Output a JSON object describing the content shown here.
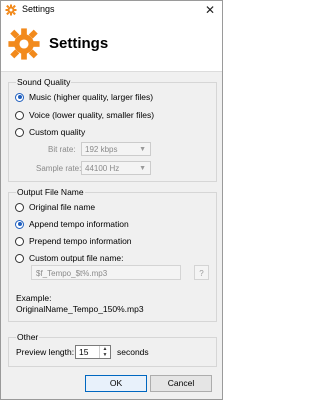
{
  "window": {
    "title": "Settings",
    "close_glyph": "✕"
  },
  "header": {
    "title": "Settings",
    "icon": "gear-icon"
  },
  "sound_quality": {
    "label": "Sound Quality",
    "options": [
      {
        "label": "Music (higher quality, larger files)",
        "selected": true
      },
      {
        "label": "Voice (lower quality, smaller files)",
        "selected": false
      },
      {
        "label": "Custom quality",
        "selected": false
      }
    ],
    "bit_rate_label": "Bit rate:",
    "bit_rate_value": "192 kbps",
    "sample_rate_label": "Sample rate:",
    "sample_rate_value": "44100 Hz"
  },
  "output_file_name": {
    "label": "Output File Name",
    "options": [
      {
        "label": "Original file name",
        "selected": false
      },
      {
        "label": "Append tempo information",
        "selected": true
      },
      {
        "label": "Prepend tempo information",
        "selected": false
      },
      {
        "label": "Custom output file name:",
        "selected": false
      }
    ],
    "custom_pattern": "$f_Tempo_$t%.mp3",
    "help_button": "?",
    "example_label": "Example:",
    "example_value": "OriginalName_Tempo_150%.mp3"
  },
  "other": {
    "label": "Other",
    "preview_label": "Preview length:",
    "preview_value": "15",
    "preview_unit": "seconds"
  },
  "buttons": {
    "ok": "OK",
    "cancel": "Cancel"
  },
  "colors": {
    "accent": "#1f5fbf",
    "icon_orange": "#f28a1c"
  }
}
